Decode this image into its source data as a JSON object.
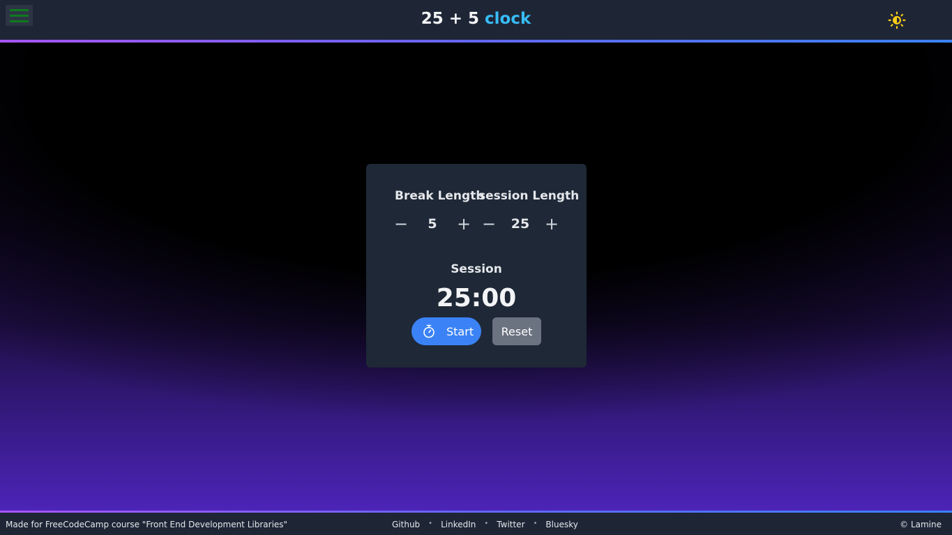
{
  "header": {
    "title_main": "25 + 5 ",
    "title_accent": "clock",
    "menu_icon": "hamburger-menu-icon",
    "theme_icon": "sun-moon-icon"
  },
  "controls": {
    "break_label": "Break Length",
    "session_label": "session Length",
    "break_value": "5",
    "session_value": "25",
    "decrement": "−",
    "increment": "+"
  },
  "timer": {
    "label": "Session",
    "time": "25:00",
    "start_label": "Start",
    "reset_label": "Reset",
    "start_icon": "stopwatch-icon"
  },
  "footer": {
    "credit": "Made for FreeCodeCamp course \"Front End Development Libraries\"",
    "links": [
      "Github",
      "LinkedIn",
      "Twitter",
      "Bluesky"
    ],
    "separator": "•",
    "copyright": "© Lamine"
  },
  "colors": {
    "accent": "#38bdf8",
    "start_button": "#3b82f6",
    "reset_button": "#6b7280",
    "card": "#1e2836",
    "header": "#1e2636",
    "theme_icon": "#facc15"
  }
}
